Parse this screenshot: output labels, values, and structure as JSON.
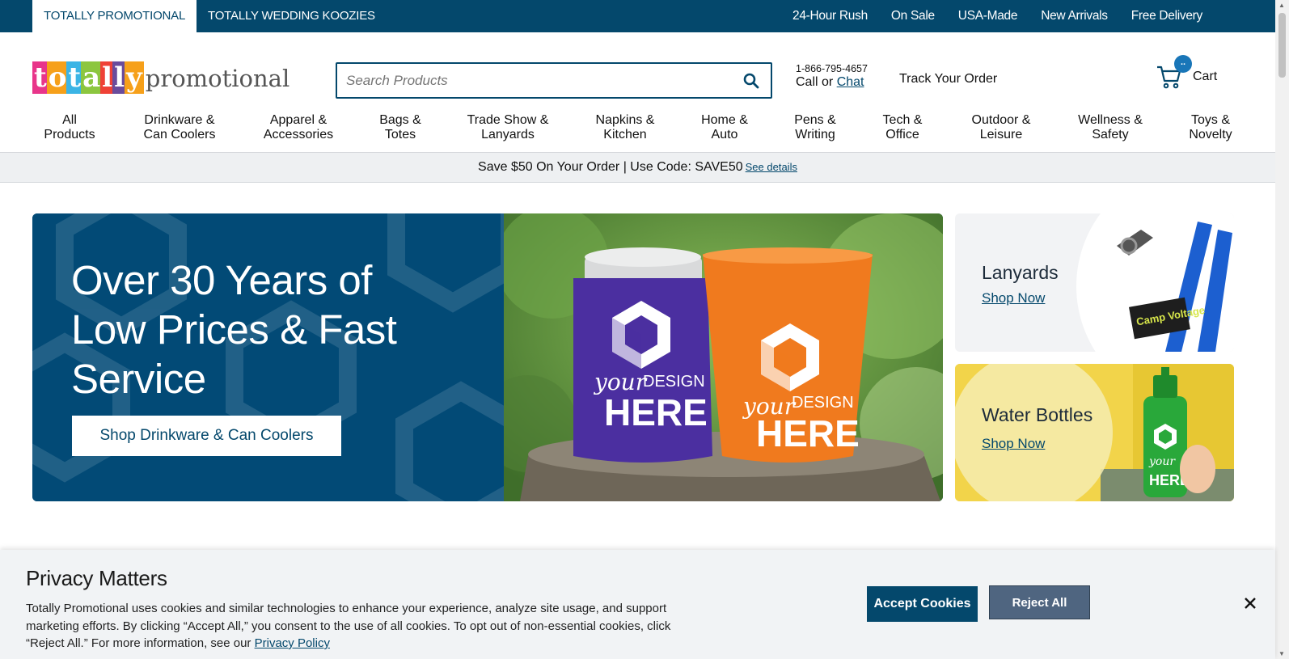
{
  "topbar": {
    "tabs": [
      "TOTALLY PROMOTIONAL",
      "TOTALLY WEDDING KOOZIES"
    ],
    "links": [
      "24-Hour Rush",
      "On Sale",
      "USA-Made",
      "New Arrivals",
      "Free Delivery"
    ]
  },
  "header": {
    "logo_tiles": [
      "t",
      "o",
      "t",
      "a",
      "l",
      "l",
      "y"
    ],
    "logo_rest": "promotional",
    "search_placeholder": "Search Products",
    "phone": "1-866-795-4657",
    "call_prefix": "Call or ",
    "chat": "Chat",
    "track": "Track Your Order",
    "cart_count": "..",
    "cart": "Cart"
  },
  "nav": [
    {
      "line1": "All",
      "line2": "Products"
    },
    {
      "line1": "Drinkware &",
      "line2": "Can Coolers"
    },
    {
      "line1": "Apparel &",
      "line2": "Accessories"
    },
    {
      "line1": "Bags &",
      "line2": "Totes"
    },
    {
      "line1": "Trade Show &",
      "line2": "Lanyards"
    },
    {
      "line1": "Napkins &",
      "line2": "Kitchen"
    },
    {
      "line1": "Home &",
      "line2": "Auto"
    },
    {
      "line1": "Pens &",
      "line2": "Writing"
    },
    {
      "line1": "Tech &",
      "line2": "Office"
    },
    {
      "line1": "Outdoor &",
      "line2": "Leisure"
    },
    {
      "line1": "Wellness &",
      "line2": "Safety"
    },
    {
      "line1": "Toys &",
      "line2": "Novelty"
    }
  ],
  "promo": {
    "text": "Save $50 On Your Order | Use Code: SAVE50",
    "see_details": "See details"
  },
  "hero": {
    "title": "Over 30 Years of Low Prices & Fast Service",
    "button": "Shop Drinkware & Can Coolers",
    "product_print_1": "your",
    "product_print_2": "DESIGN",
    "product_print_3": "HERE"
  },
  "cards": {
    "lanyards": {
      "title": "Lanyards",
      "link": "Shop Now",
      "lanyard_text": "Camp Voltage"
    },
    "water_bottles": {
      "title": "Water Bottles",
      "link": "Shop Now"
    }
  },
  "cookie": {
    "title": "Privacy Matters",
    "text": "Totally Promotional uses cookies and similar technologies to enhance your experience, analyze site usage, and support marketing efforts. By clicking “Accept All,” you consent to the use of all cookies. To opt out of non-essential cookies, click “Reject All.” For more information, see our ",
    "privacy_link": "Privacy Policy",
    "accept": "Accept Cookies",
    "reject": "Reject All"
  },
  "colors": {
    "brand_navy": "#04486c",
    "accent_blue": "#1976b8",
    "reject_gray": "#4f6580",
    "promo_bg": "#eef0f2",
    "logo_tiles": [
      "#e8358a",
      "#f6a01a",
      "#3bb4e5",
      "#8cc63f",
      "#ef4136",
      "#6a4c9c",
      "#f6a01a"
    ]
  },
  "icons": [
    "search-icon",
    "cart-icon",
    "close-icon"
  ]
}
